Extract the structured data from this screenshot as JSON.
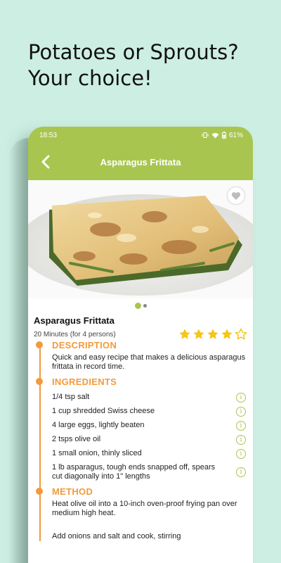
{
  "promo": {
    "headline_line1": "Potatoes or Sprouts?",
    "headline_line2": "Your choice!"
  },
  "status_bar": {
    "time": "18:53",
    "battery": "61%"
  },
  "app_bar": {
    "title": "Asparagus Frittata"
  },
  "carousel": {
    "image_icon": "frittata-photo",
    "pages": 2,
    "active_page": 1
  },
  "recipe": {
    "title": "Asparagus Frittata",
    "meta": "20 Minutes (for 4 persons)",
    "rating": 4,
    "rating_max": 5
  },
  "sections": {
    "description": {
      "title": "DESCRIPTION",
      "text": "Quick and easy recipe that makes a delicious asparagus frittata in record time."
    },
    "ingredients": {
      "title": "INGREDIENTS",
      "items": [
        "1/4 tsp salt",
        "1 cup shredded Swiss cheese",
        "4 large eggs, lightly beaten",
        "2 tsps olive oil",
        "1 small onion, thinly sliced",
        "1 lb asparagus, tough ends snapped off, spears cut diagonally into 1\" lengths"
      ]
    },
    "method": {
      "title": "METHOD",
      "steps": [
        "Heat olive oil into a 10-inch oven-proof frying pan over medium high heat.",
        "Add onions and salt and cook, stirring"
      ]
    }
  },
  "colors": {
    "accent_green": "#a8c64f",
    "accent_orange": "#f29a3c",
    "background_mint": "#cdeee2",
    "star_yellow": "#f5c518"
  }
}
